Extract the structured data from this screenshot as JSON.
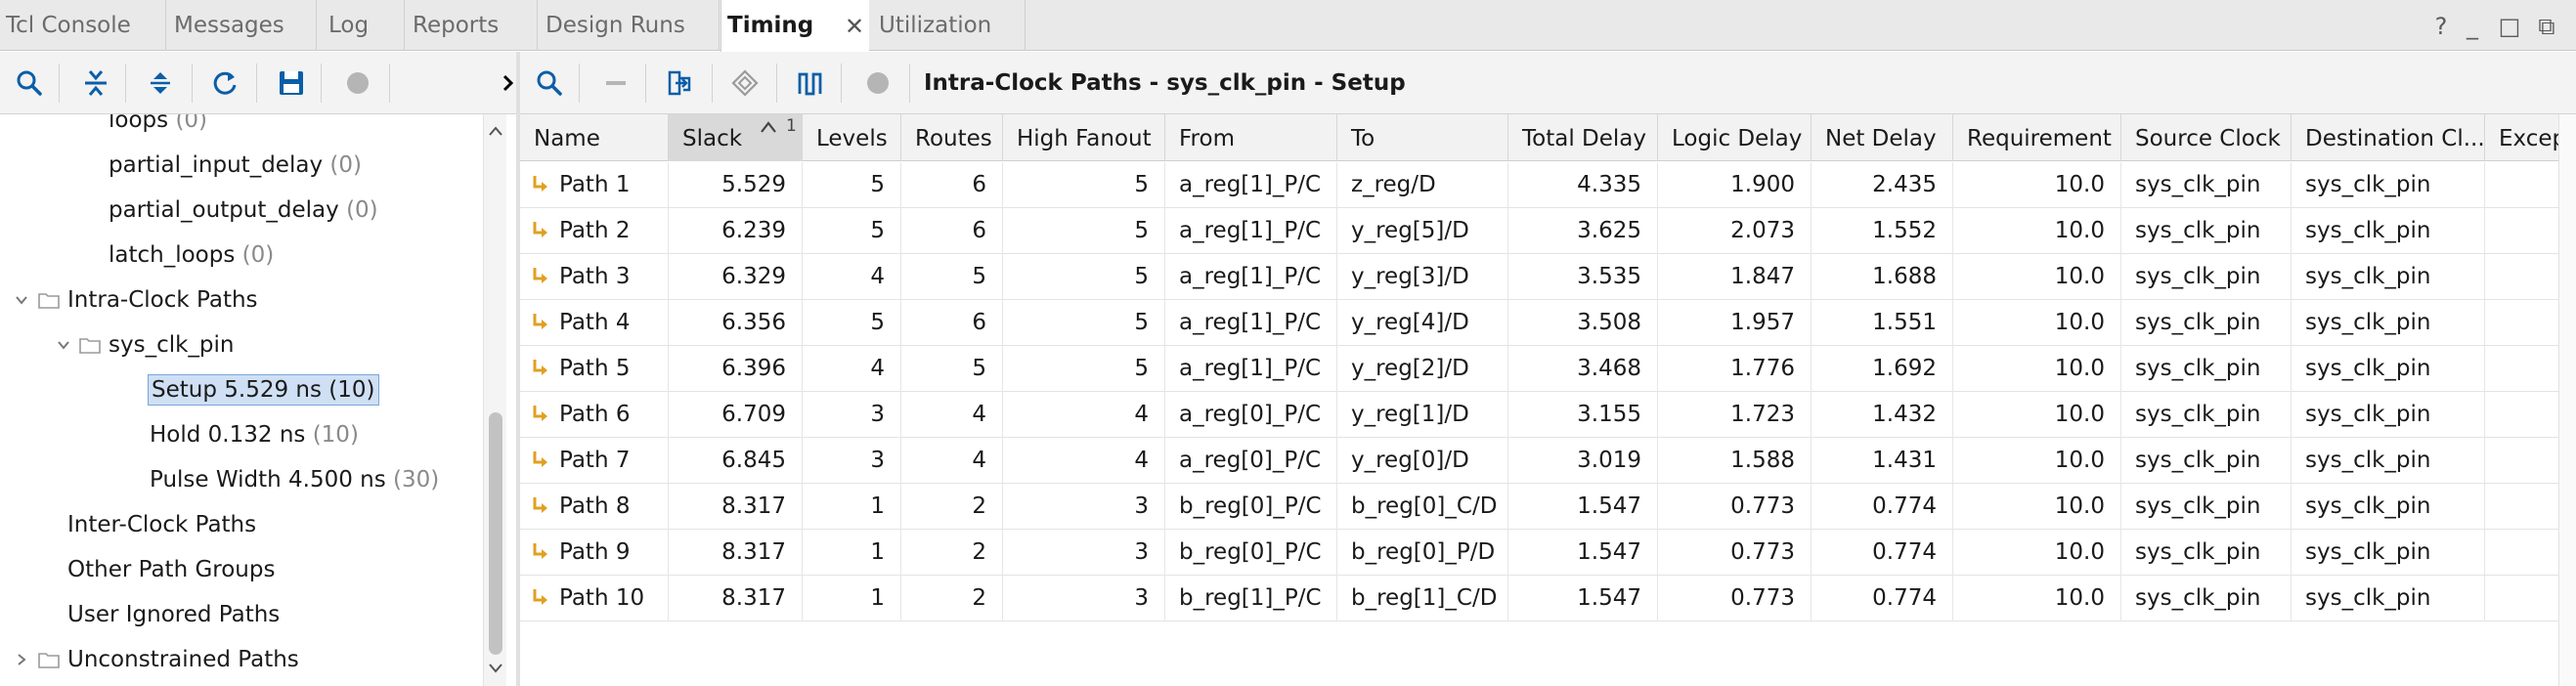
{
  "tabs": [
    {
      "label": "Tcl Console",
      "active": false
    },
    {
      "label": "Messages",
      "active": false
    },
    {
      "label": "Log",
      "active": false
    },
    {
      "label": "Reports",
      "active": false
    },
    {
      "label": "Design Runs",
      "active": false
    },
    {
      "label": "Timing",
      "active": true
    },
    {
      "label": "Utilization",
      "active": false
    }
  ],
  "window_controls": {
    "help": "?",
    "minimize": "_",
    "restore": "□",
    "popout": "⧉"
  },
  "left_toolbar_icons": [
    "search-icon",
    "collapse-all-icon",
    "expand-all-icon",
    "refresh-icon",
    "save-icon",
    "stop-icon",
    "more-icon"
  ],
  "tree": {
    "items": [
      {
        "label": "loops",
        "count": "(0)"
      },
      {
        "label": "partial_input_delay",
        "count": "(0)"
      },
      {
        "label": "partial_output_delay",
        "count": "(0)"
      },
      {
        "label": "latch_loops",
        "count": "(0)"
      },
      {
        "label": "Intra-Clock Paths",
        "count": ""
      },
      {
        "label": "sys_clk_pin",
        "count": ""
      },
      {
        "label": "Setup 5.529 ns (10)",
        "count": ""
      },
      {
        "label": "Hold 0.132 ns",
        "count": "(10)"
      },
      {
        "label": "Pulse Width 4.500 ns",
        "count": "(30)"
      },
      {
        "label": "Inter-Clock Paths",
        "count": ""
      },
      {
        "label": "Other Path Groups",
        "count": ""
      },
      {
        "label": "User Ignored Paths",
        "count": ""
      },
      {
        "label": "Unconstrained Paths",
        "count": ""
      }
    ]
  },
  "right_toolbar_icons": [
    "search-icon",
    "minus-icon",
    "schematic-icon",
    "select-icon",
    "waveform-icon",
    "stop-icon"
  ],
  "panel_title": "Intra-Clock Paths - sys_clk_pin - Setup",
  "table": {
    "sort_indicator": "1",
    "columns": [
      "Name",
      "Slack",
      "Levels",
      "Routes",
      "High Fanout",
      "From",
      "To",
      "Total Delay",
      "Logic Delay",
      "Net Delay",
      "Requirement",
      "Source Clock",
      "Destination Cl...",
      "Except"
    ],
    "rows": [
      [
        "Path 1",
        "5.529",
        "5",
        "6",
        "5",
        "a_reg[1]_P/C",
        "z_reg/D",
        "4.335",
        "1.900",
        "2.435",
        "10.0",
        "sys_clk_pin",
        "sys_clk_pin"
      ],
      [
        "Path 2",
        "6.239",
        "5",
        "6",
        "5",
        "a_reg[1]_P/C",
        "y_reg[5]/D",
        "3.625",
        "2.073",
        "1.552",
        "10.0",
        "sys_clk_pin",
        "sys_clk_pin"
      ],
      [
        "Path 3",
        "6.329",
        "4",
        "5",
        "5",
        "a_reg[1]_P/C",
        "y_reg[3]/D",
        "3.535",
        "1.847",
        "1.688",
        "10.0",
        "sys_clk_pin",
        "sys_clk_pin"
      ],
      [
        "Path 4",
        "6.356",
        "5",
        "6",
        "5",
        "a_reg[1]_P/C",
        "y_reg[4]/D",
        "3.508",
        "1.957",
        "1.551",
        "10.0",
        "sys_clk_pin",
        "sys_clk_pin"
      ],
      [
        "Path 5",
        "6.396",
        "4",
        "5",
        "5",
        "a_reg[1]_P/C",
        "y_reg[2]/D",
        "3.468",
        "1.776",
        "1.692",
        "10.0",
        "sys_clk_pin",
        "sys_clk_pin"
      ],
      [
        "Path 6",
        "6.709",
        "3",
        "4",
        "4",
        "a_reg[0]_P/C",
        "y_reg[1]/D",
        "3.155",
        "1.723",
        "1.432",
        "10.0",
        "sys_clk_pin",
        "sys_clk_pin"
      ],
      [
        "Path 7",
        "6.845",
        "3",
        "4",
        "4",
        "a_reg[0]_P/C",
        "y_reg[0]/D",
        "3.019",
        "1.588",
        "1.431",
        "10.0",
        "sys_clk_pin",
        "sys_clk_pin"
      ],
      [
        "Path 8",
        "8.317",
        "1",
        "2",
        "3",
        "b_reg[0]_P/C",
        "b_reg[0]_C/D",
        "1.547",
        "0.773",
        "0.774",
        "10.0",
        "sys_clk_pin",
        "sys_clk_pin"
      ],
      [
        "Path 9",
        "8.317",
        "1",
        "2",
        "3",
        "b_reg[0]_P/C",
        "b_reg[0]_P/D",
        "1.547",
        "0.773",
        "0.774",
        "10.0",
        "sys_clk_pin",
        "sys_clk_pin"
      ],
      [
        "Path 10",
        "8.317",
        "1",
        "2",
        "3",
        "b_reg[1]_P/C",
        "b_reg[1]_C/D",
        "1.547",
        "0.773",
        "0.774",
        "10.0",
        "sys_clk_pin",
        "sys_clk_pin"
      ]
    ]
  },
  "colors": {
    "accent": "#0a5ea8",
    "selection": "#cfe0f5",
    "path_icon": "#e0a020"
  }
}
